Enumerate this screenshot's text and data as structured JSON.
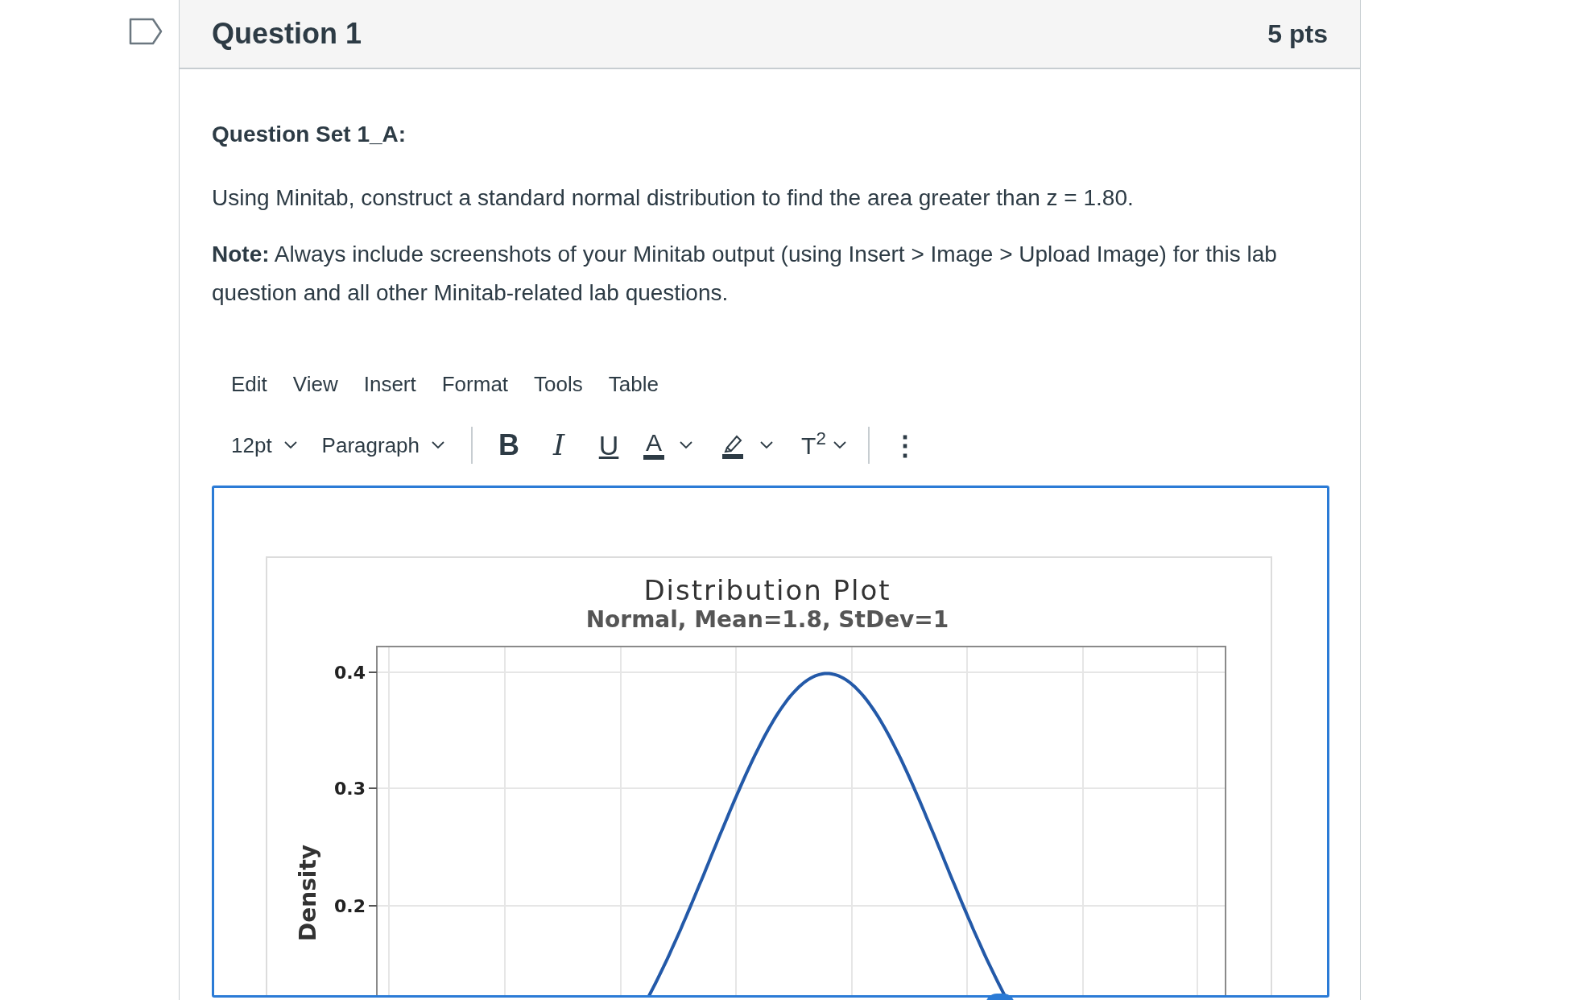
{
  "question": {
    "title": "Question 1",
    "points": "5 pts"
  },
  "body": [
    {
      "kind": "heading",
      "text": "Question Set 1_A:"
    },
    {
      "kind": "paragraph",
      "text": "Using Minitab, construct a standard normal distribution to find the area greater than z = 1.80."
    },
    {
      "kind": "paragraph",
      "text": "**Note:** Always include screenshots of your Minitab output (using Insert > Image > Upload Image) for this lab question and all other Minitab-related lab questions."
    }
  ],
  "editor": {
    "menu": [
      "Edit",
      "View",
      "Insert",
      "Format",
      "Tools",
      "Table"
    ],
    "toolbar": [
      {
        "kind": "dropdown",
        "label": "12pt"
      },
      {
        "kind": "dropdown",
        "label": "Paragraph"
      },
      {
        "kind": "separator"
      },
      {
        "kind": "bold",
        "label": "B"
      },
      {
        "kind": "italic",
        "label": "I"
      },
      {
        "kind": "underline",
        "label": "U"
      },
      {
        "kind": "text-color",
        "label": "A"
      },
      {
        "kind": "highlight"
      },
      {
        "kind": "superscript",
        "label": "T$^{2}$"
      },
      {
        "kind": "separator"
      },
      {
        "kind": "more",
        "label": "⋮"
      }
    ],
    "chart": {
      "title": "Distribution Plot",
      "subtitle": "Normal, Mean=1.8, StDev=1",
      "ylabel": "Density",
      "yticks": [
        "0.4",
        "0.3",
        "0.2"
      ]
    }
  }
}
